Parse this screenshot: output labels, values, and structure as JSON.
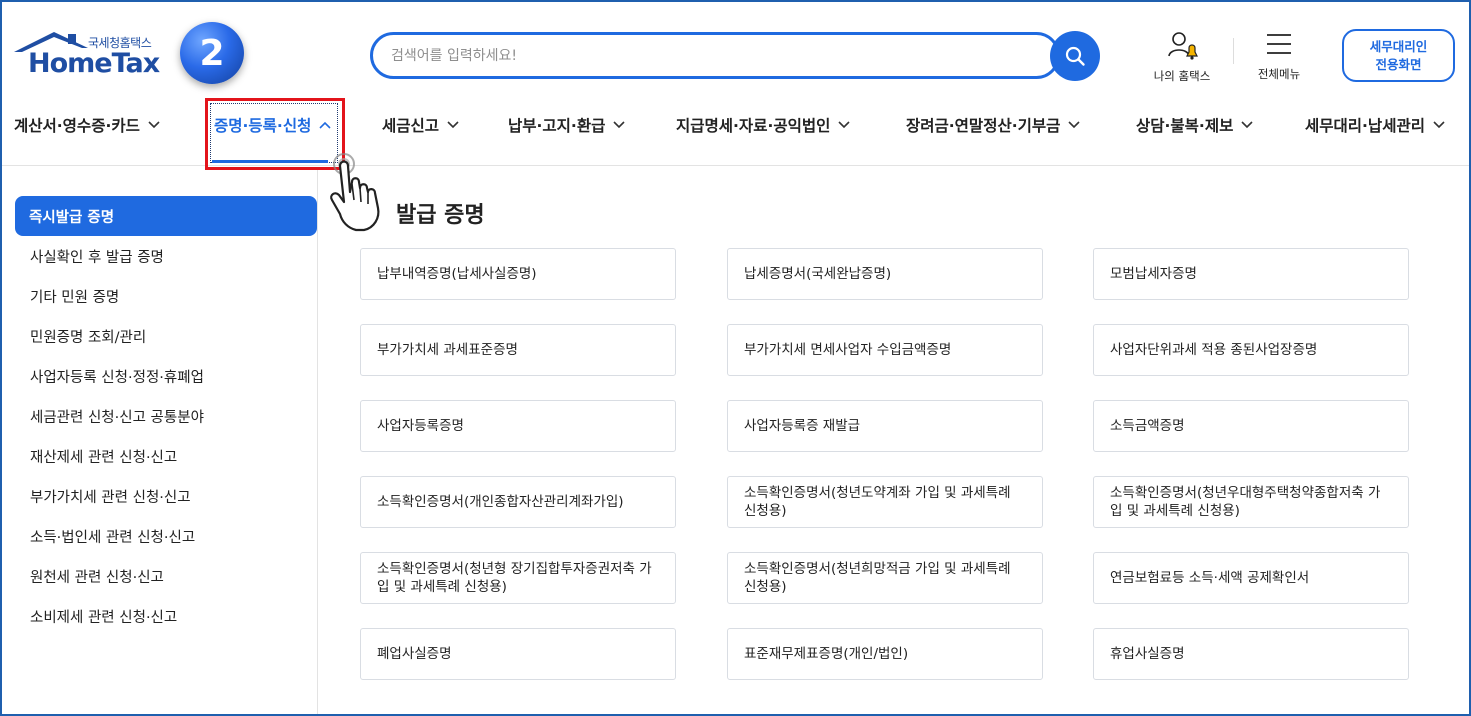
{
  "header": {
    "logo_small": "국세청홈택스",
    "logo_main": "HomeTax",
    "step_number": "2",
    "search_placeholder": "검색어를 입력하세요!",
    "my_home_label": "나의 홈택스",
    "all_menu_label": "전체메뉴",
    "tax_agent_line1": "세무대리인",
    "tax_agent_line2": "전용화면"
  },
  "nav": {
    "items": [
      {
        "label": "계산서·영수증·카드"
      },
      {
        "label": "증명·등록·신청"
      },
      {
        "label": "세금신고"
      },
      {
        "label": "납부·고지·환급"
      },
      {
        "label": "지급명세·자료·공익법인"
      },
      {
        "label": "장려금·연말정산·기부금"
      },
      {
        "label": "상담·불복·제보"
      },
      {
        "label": "세무대리·납세관리"
      }
    ],
    "active_index": 1
  },
  "sidebar": {
    "active": "즉시발급 증명",
    "items": [
      "사실확인 후 발급 증명",
      "기타 민원 증명",
      "민원증명 조회/관리",
      "사업자등록 신청·정정·휴폐업",
      "세금관련 신청·신고 공통분야",
      "재산제세 관련 신청·신고",
      "부가가치세 관련 신청·신고",
      "소득·법인세 관련 신청·신고",
      "원천세 관련 신청·신고",
      "소비제세 관련 신청·신고"
    ]
  },
  "main": {
    "title": "발급 증명",
    "cards": [
      "납부내역증명(납세사실증명)",
      "납세증명서(국세완납증명)",
      "모범납세자증명",
      "부가가치세 과세표준증명",
      "부가가치세 면세사업자 수입금액증명",
      "사업자단위과세 적용 종된사업장증명",
      "사업자등록증명",
      "사업자등록증 재발급",
      "소득금액증명",
      "소득확인증명서(개인종합자산관리계좌가입)",
      "소득확인증명서(청년도약계좌 가입 및 과세특례 신청용)",
      "소득확인증명서(청년우대형주택청약종합저축 가입 및 과세특례 신청용)",
      "소득확인증명서(청년형 장기집합투자증권저축 가입 및 과세특례 신청용)",
      "소득확인증명서(청년희망적금 가입 및 과세특례 신청용)",
      "연금보험료등 소득·세액 공제확인서",
      "폐업사실증명",
      "표준재무제표증명(개인/법인)",
      "휴업사실증명"
    ]
  },
  "colors": {
    "accent": "#1f6ae0",
    "logo": "#1f4ea3",
    "highlight": "#e3141b"
  }
}
